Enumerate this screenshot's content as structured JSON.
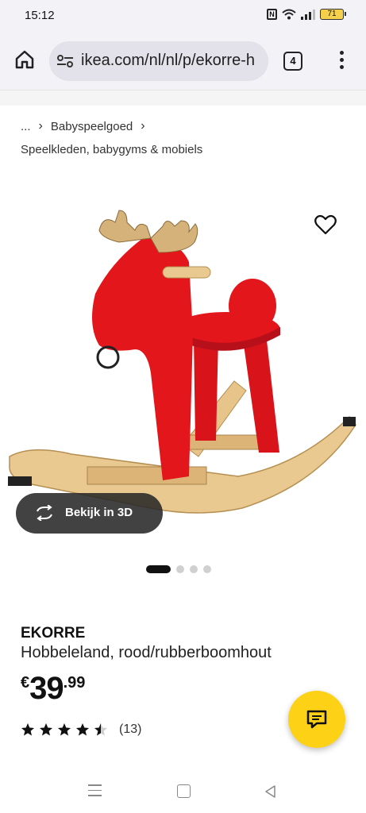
{
  "status": {
    "time": "15:12",
    "battery": "71"
  },
  "browser": {
    "url": "ikea.com/nl/nl/p/ekorre-h",
    "tab_count": "4"
  },
  "breadcrumb": {
    "ellipsis": "...",
    "level1": "Babyspeelgoed",
    "level2": "Speelkleden, babygyms & mobiels"
  },
  "gallery": {
    "view3d_label": "Bekijk in 3D",
    "image_count": 4,
    "active_index": 0
  },
  "product": {
    "name": "EKORRE",
    "description": "Hobbeleland, rood/rubberboomhout",
    "price": {
      "currency": "€",
      "integer": "39",
      "decimals": ".99"
    },
    "rating": {
      "value": 4.5,
      "max": 5,
      "count": "(13)"
    }
  },
  "colors": {
    "accent": "#fcd116",
    "product_red": "#e3161b",
    "wood": "#e9c98f"
  }
}
